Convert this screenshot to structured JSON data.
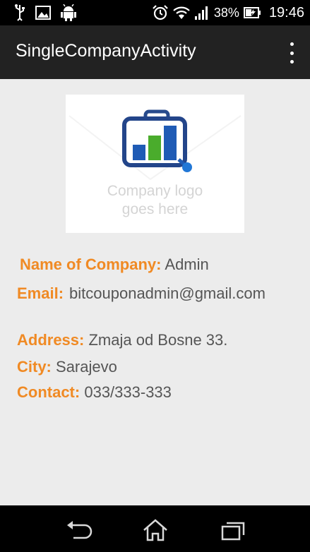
{
  "status_bar": {
    "battery_percent": "38%",
    "time": "19:46",
    "icons": [
      "usb-icon",
      "image-icon",
      "android-icon",
      "alarm-icon",
      "wifi-icon",
      "signal-icon",
      "battery-icon"
    ]
  },
  "action_bar": {
    "title": "SingleCompanyActivity",
    "overflow_icon": "overflow-menu-icon"
  },
  "logo": {
    "caption_line1": "Company logo",
    "caption_line2": "goes here"
  },
  "company": {
    "name_label": "Name of Company:",
    "name_value": "Admin",
    "email_label": "Email:",
    "email_value": "bitcouponadmin@gmail.com",
    "address_label": "Address:",
    "address_value": "Zmaja od Bosne 33.",
    "city_label": "City:",
    "city_value": "Sarajevo",
    "contact_label": "Contact:",
    "contact_value": "033/333-333"
  },
  "nav_bar": {
    "icons": [
      "back-icon",
      "home-icon",
      "recent-apps-icon"
    ]
  },
  "colors": {
    "label": "#f08a24",
    "value": "#555555",
    "action_bar": "#222222",
    "background": "#ececec"
  }
}
